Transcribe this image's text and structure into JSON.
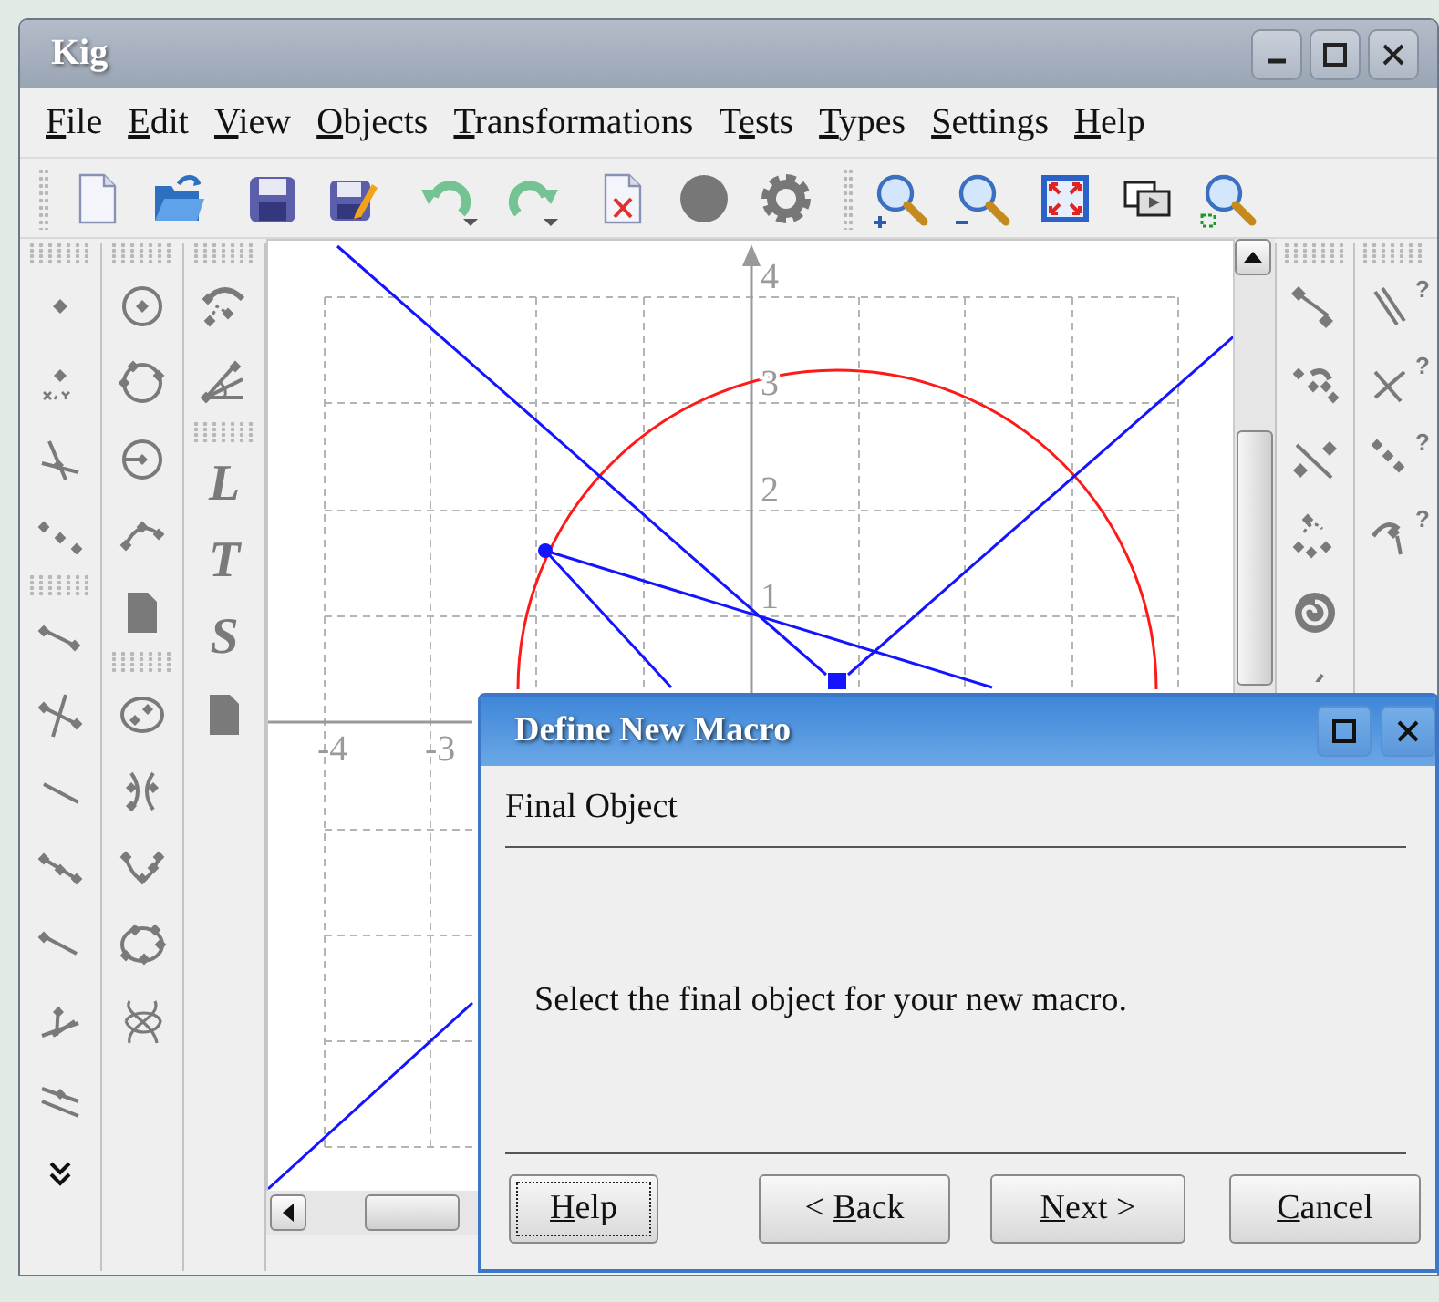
{
  "window": {
    "title": "Kig"
  },
  "menu": [
    {
      "key": "F",
      "post": "ile"
    },
    {
      "key": "E",
      "post": "dit"
    },
    {
      "key": "V",
      "post": "iew"
    },
    {
      "key": "O",
      "post": "bjects"
    },
    {
      "key": "T",
      "post": "ransformations"
    },
    {
      "pre": "T",
      "key": "e",
      "post": "sts"
    },
    {
      "key": "T",
      "post": "ypes"
    },
    {
      "key": "S",
      "post": "ettings"
    },
    {
      "key": "H",
      "post": "elp"
    }
  ],
  "text_tools": [
    "L",
    "T",
    "S"
  ],
  "test_marks": [
    "?",
    "?",
    "?",
    "?"
  ],
  "canvas": {
    "y_labels": [
      "4",
      "3",
      "2",
      "1"
    ],
    "x_labels": [
      "-4",
      "-3"
    ]
  },
  "dialog": {
    "title": "Define New Macro",
    "page_title": "Final Object",
    "message": "Select the final object for your new macro.",
    "buttons": [
      {
        "key": "H",
        "post": "elp",
        "focused": true
      },
      {
        "pre": "< ",
        "key": "B",
        "post": "ack",
        "focused": false
      },
      {
        "key": "N",
        "post": "ext >",
        "focused": false
      },
      {
        "key": "C",
        "post": "ancel",
        "focused": false
      }
    ]
  }
}
